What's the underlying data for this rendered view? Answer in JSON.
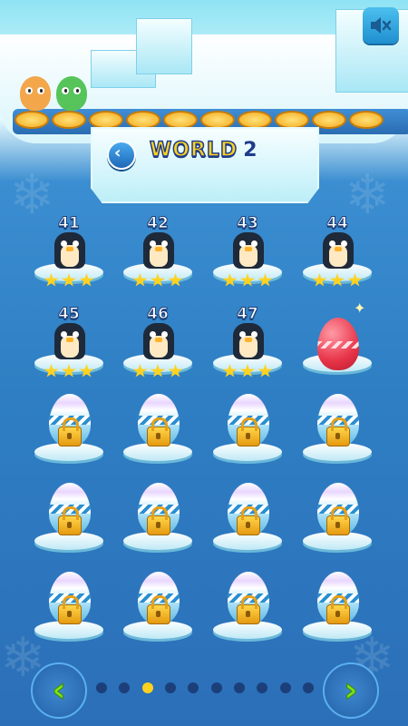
{
  "header": {
    "world_label": "WORLD",
    "world_number": "2"
  },
  "characters": [
    "dog-character",
    "frog-character"
  ],
  "levels": [
    {
      "number": "41",
      "state": "completed",
      "stars": 3
    },
    {
      "number": "42",
      "state": "completed",
      "stars": 3
    },
    {
      "number": "43",
      "state": "completed",
      "stars": 3
    },
    {
      "number": "44",
      "state": "completed",
      "stars": 3
    },
    {
      "number": "45",
      "state": "completed",
      "stars": 3
    },
    {
      "number": "46",
      "state": "completed",
      "stars": 3
    },
    {
      "number": "47",
      "state": "completed",
      "stars": 3
    },
    {
      "number": "",
      "state": "current-egg",
      "stars": 0
    },
    {
      "number": "",
      "state": "locked",
      "stars": 0
    },
    {
      "number": "",
      "state": "locked",
      "stars": 0
    },
    {
      "number": "",
      "state": "locked",
      "stars": 0
    },
    {
      "number": "",
      "state": "locked",
      "stars": 0
    },
    {
      "number": "",
      "state": "locked",
      "stars": 0
    },
    {
      "number": "",
      "state": "locked",
      "stars": 0
    },
    {
      "number": "",
      "state": "locked",
      "stars": 0
    },
    {
      "number": "",
      "state": "locked",
      "stars": 0
    },
    {
      "number": "",
      "state": "locked",
      "stars": 0
    },
    {
      "number": "",
      "state": "locked",
      "stars": 0
    },
    {
      "number": "",
      "state": "locked",
      "stars": 0
    },
    {
      "number": "",
      "state": "locked",
      "stars": 0
    }
  ],
  "pagination": {
    "page_count": 10,
    "current_page": 3
  },
  "controls": {
    "mute_icon": "speaker-muted-icon",
    "back_icon": "chevron-left-icon",
    "prev_icon": "chevron-left-icon",
    "next_icon": "chevron-right-icon"
  },
  "colors": {
    "star": "#ffd21f",
    "title": "#ffd21f",
    "accent_green": "#7ee21a",
    "background": "#2f7fc4"
  }
}
